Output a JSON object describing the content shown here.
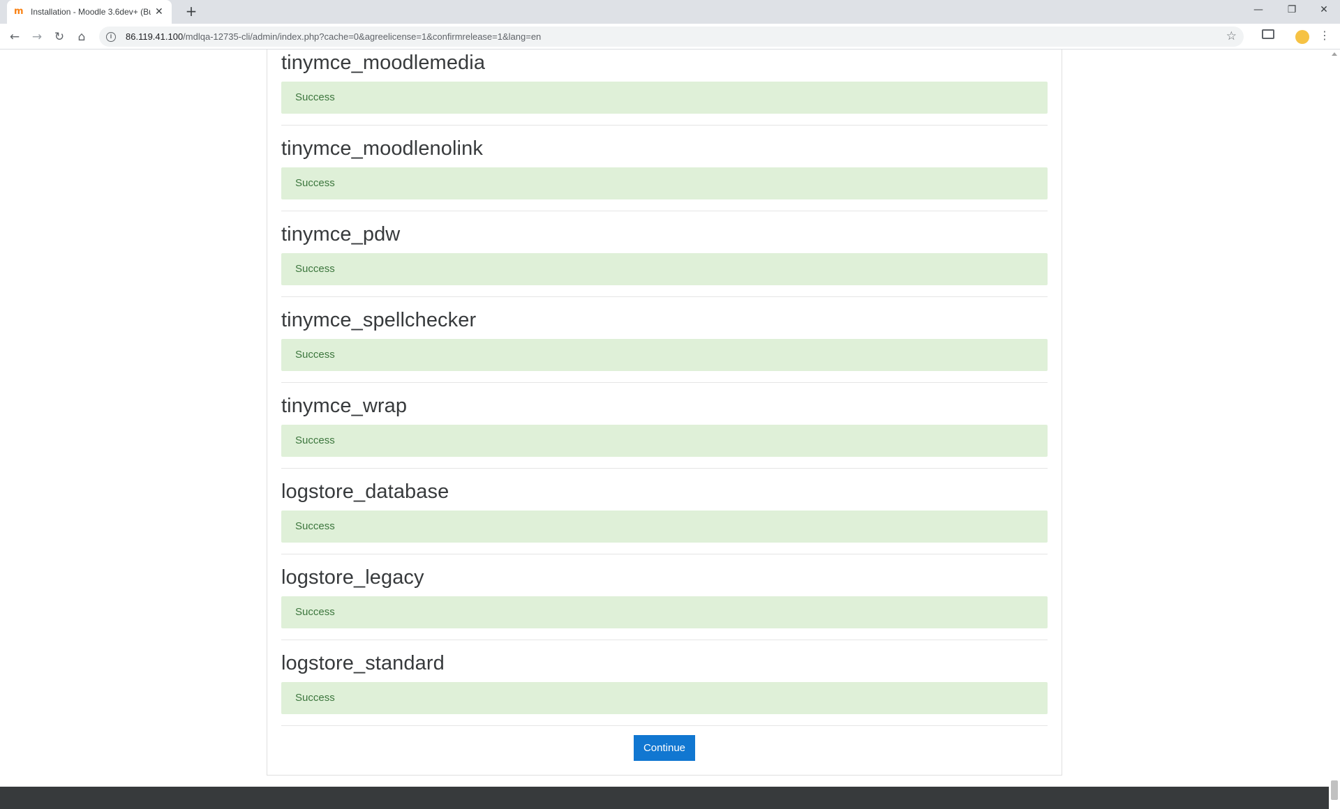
{
  "browser": {
    "tab_title": "Installation - Moodle 3.6dev+ (Bu",
    "favicon": "m",
    "url_host": "86.119.41.100",
    "url_path": "/mdlqa-12735-cli/admin/index.php?cache=0&agreelicense=1&confirmrelease=1&lang=en"
  },
  "plugins": [
    {
      "name": "tinymce_moodlemedia",
      "status": "Success"
    },
    {
      "name": "tinymce_moodlenolink",
      "status": "Success"
    },
    {
      "name": "tinymce_pdw",
      "status": "Success"
    },
    {
      "name": "tinymce_spellchecker",
      "status": "Success"
    },
    {
      "name": "tinymce_wrap",
      "status": "Success"
    },
    {
      "name": "logstore_database",
      "status": "Success"
    },
    {
      "name": "logstore_legacy",
      "status": "Success"
    },
    {
      "name": "logstore_standard",
      "status": "Success"
    }
  ],
  "continue_label": "Continue",
  "colors": {
    "success_bg": "#dff0d8",
    "success_text": "#3c763d",
    "primary": "#1177d1",
    "footer": "#373a3c"
  }
}
